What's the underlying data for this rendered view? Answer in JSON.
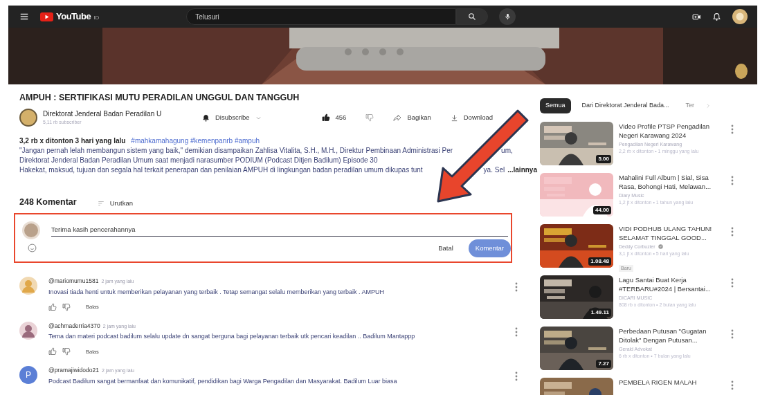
{
  "topbar": {
    "logo": "YouTube",
    "region": "ID",
    "search": {
      "placeholder": "Telusuri"
    }
  },
  "video": {
    "title": "AMPUH : SERTIFIKASI MUTU PERADILAN UNGGUL DAN TANGGUH",
    "channel": {
      "name": "Direktorat Jenderal Badan Peradilan U",
      "subscribers": "5,11 rb subscriber"
    },
    "subscribe": {
      "label": "Disubscribe",
      "subscribed": true
    },
    "likes": "456",
    "liked": true,
    "actions": [
      {
        "kind": "share",
        "label": "Bagikan"
      },
      {
        "kind": "download",
        "label": "Download"
      }
    ]
  },
  "description": {
    "stats": "3,2 rb x ditonton  3 hari yang lalu",
    "hashtags": "#mahkamahagung #kemenpanrb #ampuh",
    "lines": [
      [
        "\"Jangan pernah lelah membangun sistem yang baik,\" demikian disampaikan Zahlisa Vitalita, S.H., M.H., Direktur Pembinaan Administrasi Per",
        "um,"
      ],
      [
        "Direktorat Jenderal Badan Peradilan Umum saat menjadi narasumber PODIUM (Podcast Ditjen Badilum) Episode 30"
      ],
      [
        "Hakekat, maksud, tujuan dan segala hal terkait penerapan dan penilaian AMPUH di lingkungan badan peradilan umum dikupas tunt",
        "ya. Sel"
      ]
    ],
    "more": "...lainnya"
  },
  "comments_header": {
    "count": "248 Komentar",
    "sort": "Urutkan"
  },
  "composer": {
    "value": "Terima kasih pencerahannya",
    "cancel": "Batal",
    "submit": "Komentar"
  },
  "comments": [
    {
      "author": "@mariomumu1581",
      "time": "2 jam yang lalu",
      "text": "Inovasi tiada henti untuk memberikan pelayanan yang terbaik . Tetap semangat selalu memberikan yang terbaik . AMPUH",
      "reply": "Balas"
    },
    {
      "author": "@achmaderria4370",
      "time": "2 jam yang lalu",
      "text": "Tema dan materi podcast badilum selalu update dn sangat berguna bagi pelayanan terbaik utk pencari keadilan .. Badilum Mantappp",
      "reply": "Balas"
    },
    {
      "kind": "letter",
      "letter": "P",
      "color": "#5b7fd6",
      "author": "@pramajiwidodo21",
      "time": "2 jam yang lalu",
      "text": "Podcast Badilum sangat bermanfaat dan komunikatif, pendidikan bagi Warga Pengadilan dan Masyarakat. Badilum Luar biasa"
    }
  ],
  "sidebar": {
    "chips": [
      {
        "label": "Semua",
        "selected": true
      },
      {
        "label": "Dari Direktorat Jenderal Bada...",
        "selected": false
      },
      {
        "label": "Ter",
        "selected": false
      }
    ],
    "videos": [
      {
        "title": "Video Profile PTSP Pengadilan Negeri Karawang 2024",
        "channel": "Pengadilan Negeri Karawang",
        "meta": "2,2 rb x ditonton • 1 minggu yang lalu",
        "duration": "5.00"
      },
      {
        "title": "Mahalini Full Album | Sial, Sisa Rasa, Bohongi Hati, Melawan...",
        "channel": "Diary Music",
        "meta": "1,2 jt x ditonton • 1 tahun yang lalu",
        "duration": "44.00"
      },
      {
        "title": "VIDI PODHUB ULANG TAHUN! SELAMAT TINGGAL GOOD...",
        "channel": "Deddy Corbuzier",
        "verified": true,
        "meta": "3,1 jt x ditonton • 5 hari yang lalu",
        "badge": "Baru",
        "duration": "1.08.48"
      },
      {
        "title": "Lagu Santai Buat Kerja #TERBARU#2024 | Bersantai...",
        "channel": "DICARI MUSIC",
        "meta": "808 rb x ditonton • 2 bulan yang lalu",
        "duration": "1.49.11"
      },
      {
        "title": "Perbedaan Putusan \"Gugatan Ditolak\" Dengan Putusan...",
        "channel": "Gerald Advokat",
        "meta": "6 rb x ditonton • 7 bulan yang lalu",
        "duration": "7.27"
      },
      {
        "title": "PEMBELA RIGEN MALAH"
      }
    ]
  }
}
